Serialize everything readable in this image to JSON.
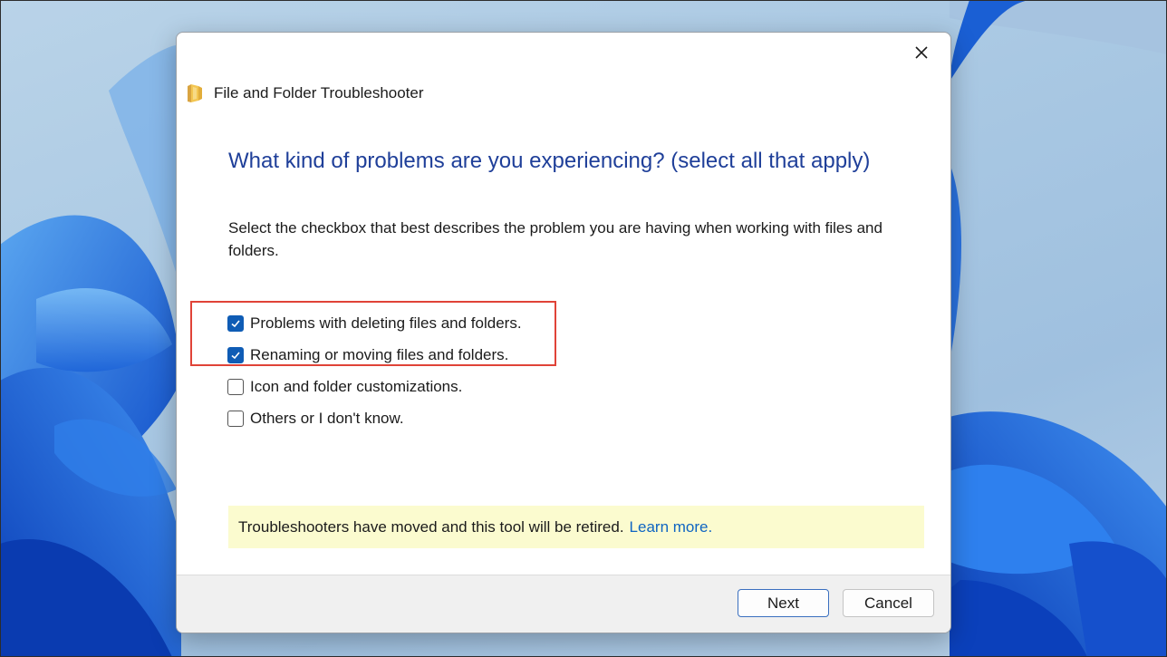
{
  "window": {
    "title": "File and Folder Troubleshooter",
    "close_icon": "close-icon",
    "title_icon": "folder-icon"
  },
  "content": {
    "heading": "What kind of problems are you experiencing? (select all that apply)",
    "description": "Select the checkbox that best describes the problem you are having when working with files and folders.",
    "options": [
      {
        "label": "Problems with deleting files and folders.",
        "checked": true
      },
      {
        "label": "Renaming or moving files and folders.",
        "checked": true
      },
      {
        "label": "Icon and folder customizations.",
        "checked": false
      },
      {
        "label": "Others or I don't know.",
        "checked": false
      }
    ]
  },
  "notice": {
    "text": "Troubleshooters have moved and this tool will be retired.",
    "link": "Learn more."
  },
  "footer": {
    "next_label": "Next",
    "cancel_label": "Cancel"
  },
  "colors": {
    "heading": "#1f3f99",
    "checkbox_checked": "#0f5cb5",
    "highlight_border": "#e04338",
    "notice_background": "#fbfbcf",
    "link": "#0f65c2"
  }
}
